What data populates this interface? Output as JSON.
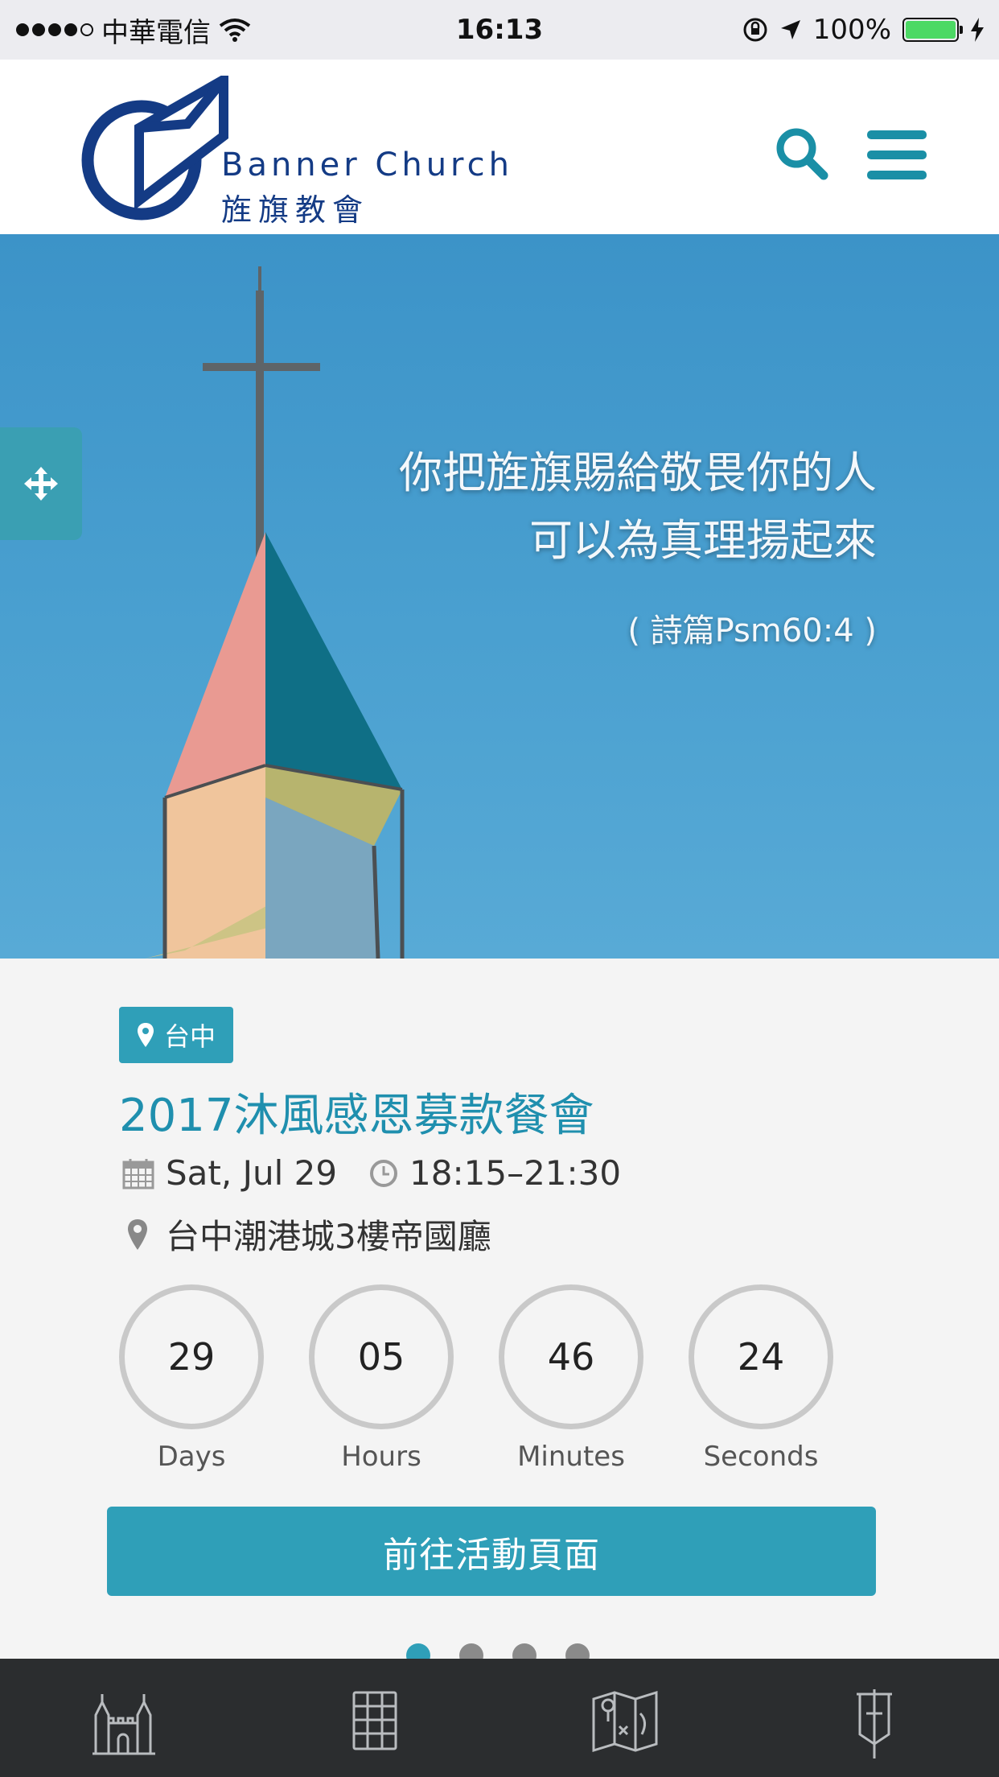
{
  "status_bar": {
    "carrier": "中華電信",
    "time": "16:13",
    "battery": "100%"
  },
  "header": {
    "logo_en": "Banner Church",
    "logo_zh": "旌旗教會",
    "icons": [
      "search-icon",
      "menu-icon"
    ],
    "brand_color": "#143b85",
    "accent_color": "#1a8fa6"
  },
  "hero": {
    "quote_line1": "你把旌旗賜給敬畏你的人",
    "quote_line2": "可以為真理揚起來",
    "reference": "( 詩篇Psm60:4 )"
  },
  "event": {
    "location_badge": "台中",
    "title": "2017沐風感恩募款餐會",
    "date": "Sat, Jul 29",
    "time": "18:15–21:30",
    "venue": "台中潮港城3樓帝國廳",
    "countdown": [
      {
        "value": "29",
        "label": "Days"
      },
      {
        "value": "05",
        "label": "Hours"
      },
      {
        "value": "46",
        "label": "Minutes"
      },
      {
        "value": "24",
        "label": "Seconds"
      }
    ],
    "cta_label": "前往活動頁面",
    "carousel_active": 1,
    "carousel_total": 4
  },
  "tab_bar": {
    "tabs": [
      "church-icon",
      "grid-icon",
      "map-icon",
      "banner-icon"
    ]
  }
}
